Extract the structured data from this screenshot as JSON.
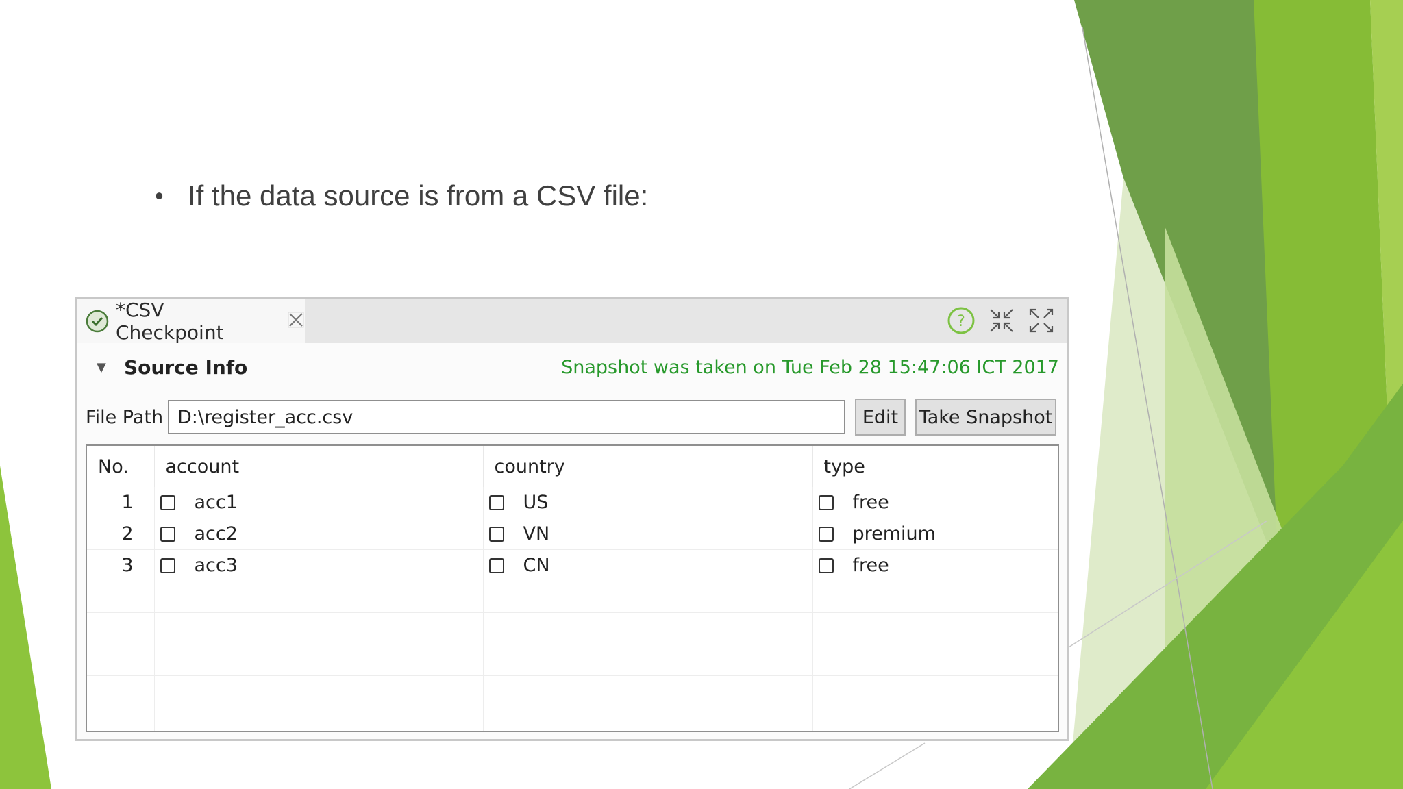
{
  "slide": {
    "bullet_symbol": "•",
    "bullet_text": "If the data source is from a CSV file:"
  },
  "panel": {
    "tab_title": "*CSV Checkpoint",
    "icons": [
      "checkpoint-icon",
      "close-tab-icon",
      "help-icon",
      "minimize-icon",
      "maximize-icon"
    ],
    "section_title": "Source Info",
    "snapshot_status": "Snapshot was taken on Tue Feb 28 15:47:06 ICT 2017",
    "file_path_label": "File Path",
    "file_path_value": "D:\\register_acc.csv",
    "edit_label": "Edit",
    "take_snapshot_label": "Take Snapshot"
  },
  "table": {
    "columns": [
      "No.",
      "account",
      "country",
      "type"
    ],
    "rows": [
      {
        "no": "1",
        "account": "acc1",
        "country": "US",
        "type": "free"
      },
      {
        "no": "2",
        "account": "acc2",
        "country": "VN",
        "type": "premium"
      },
      {
        "no": "3",
        "account": "acc3",
        "country": "CN",
        "type": "free"
      }
    ]
  },
  "colors": {
    "accent_green": "#27992b",
    "deco_green_dark": "#5f9a3a",
    "deco_green_light": "#8dc43c"
  }
}
